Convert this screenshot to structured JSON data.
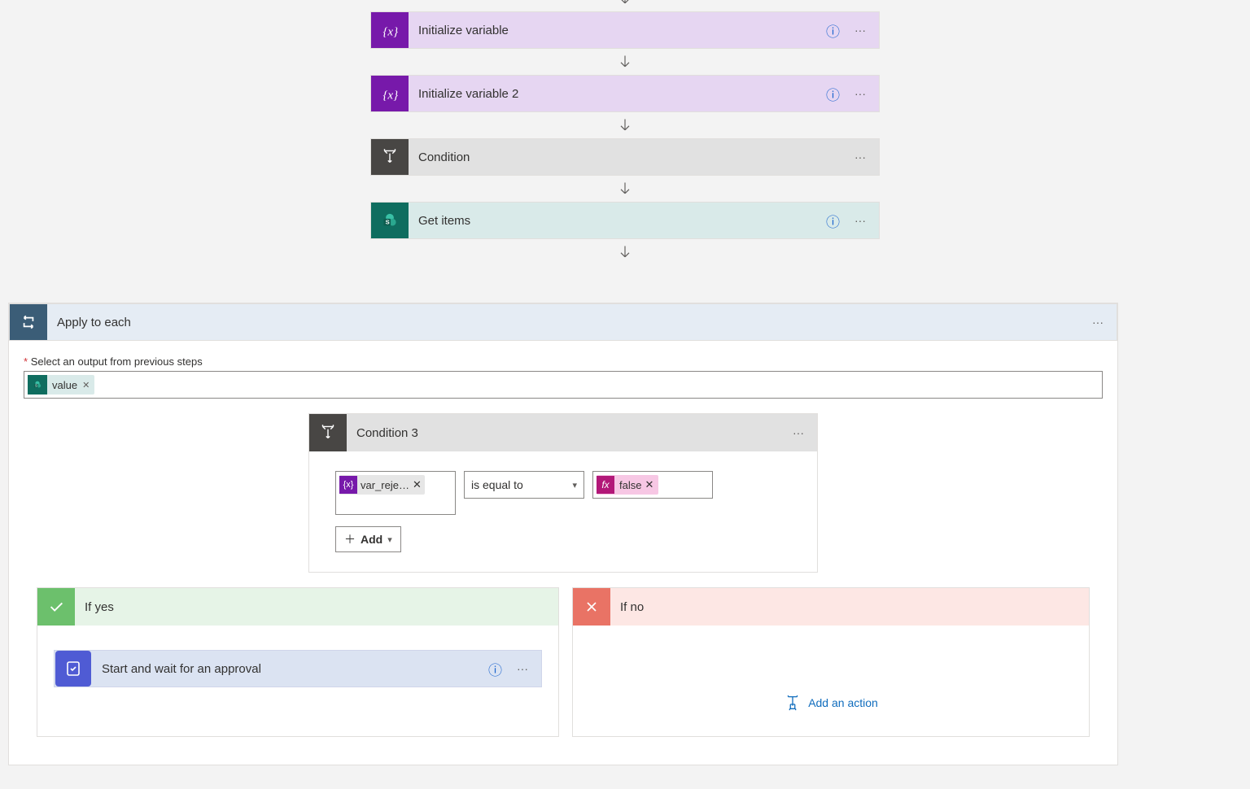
{
  "steps": {
    "init_var": "Initialize variable",
    "init_var2": "Initialize variable 2",
    "condition": "Condition",
    "get_items": "Get items",
    "apply_each": "Apply to each",
    "condition3": "Condition 3",
    "start_approval": "Start and wait for an approval"
  },
  "apply": {
    "label": "Select an output from previous steps",
    "token_value": "value"
  },
  "condition3": {
    "left_token": "var_reje…",
    "operator": "is equal to",
    "right_token": "false",
    "add_label": "Add"
  },
  "branches": {
    "yes": "If yes",
    "no": "If no",
    "add_action": "Add an action"
  }
}
